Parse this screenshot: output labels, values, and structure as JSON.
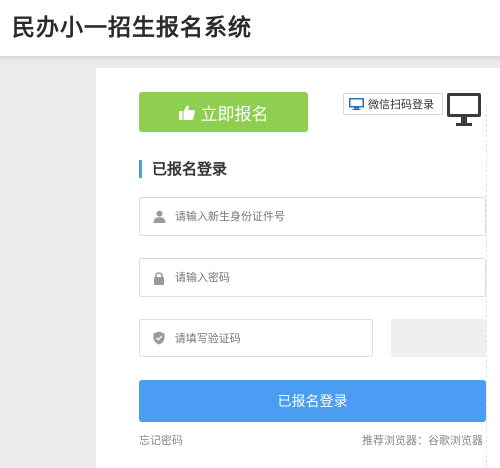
{
  "header": {
    "title": "民办小一招生报名系统"
  },
  "apply": {
    "label": "立即报名",
    "icon": "thumbs-up-icon"
  },
  "wechat": {
    "label": "微信扫码登录",
    "icon": "monitor-icon"
  },
  "login": {
    "section_title": "已报名登录",
    "id_placeholder": "请输入新生身份证件号",
    "password_placeholder": "请输入密码",
    "captcha_placeholder": "请填写验证码",
    "submit_label": "已报名登录",
    "forgot_label": "忘记密码",
    "browser_tip": "推荐浏览器：谷歌浏览器"
  },
  "colors": {
    "apply_button": "#8ecf4f",
    "login_button": "#4a9df2",
    "section_accent": "#4a9de8"
  }
}
